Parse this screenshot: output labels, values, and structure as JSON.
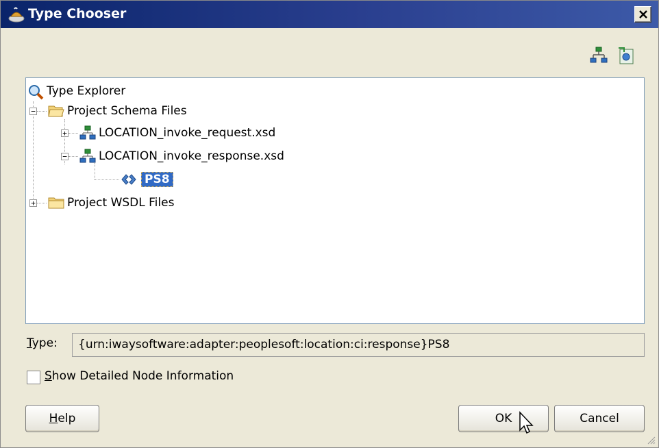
{
  "window": {
    "title": "Type Chooser",
    "close_icon": "close-icon"
  },
  "toolbar": {
    "buttons": [
      {
        "icon": "schema-tree-icon"
      },
      {
        "icon": "import-schema-icon"
      }
    ]
  },
  "tree": {
    "root_label": "Type Explorer",
    "nodes": [
      {
        "label": "Project Schema Files",
        "expanded": true
      },
      {
        "label": "LOCATION_invoke_request.xsd",
        "expanded": false
      },
      {
        "label": "LOCATION_invoke_response.xsd",
        "expanded": true
      },
      {
        "label": "PS8",
        "selected": true
      },
      {
        "label": "Project WSDL Files",
        "expanded": false
      }
    ]
  },
  "type_field": {
    "label_prefix": "T",
    "label_rest": "ype:",
    "value": "{urn:iwaysoftware:adapter:peoplesoft:location:ci:response}PS8"
  },
  "checkbox": {
    "label_prefix": "S",
    "label_rest": "how Detailed Node Information",
    "checked": false
  },
  "buttons": {
    "help_prefix": "H",
    "help_rest": "elp",
    "ok": "OK",
    "cancel": "Cancel"
  },
  "colors": {
    "titlebar": "#0a246a",
    "selection": "#316ac5",
    "dialog_bg": "#ece9d8"
  }
}
